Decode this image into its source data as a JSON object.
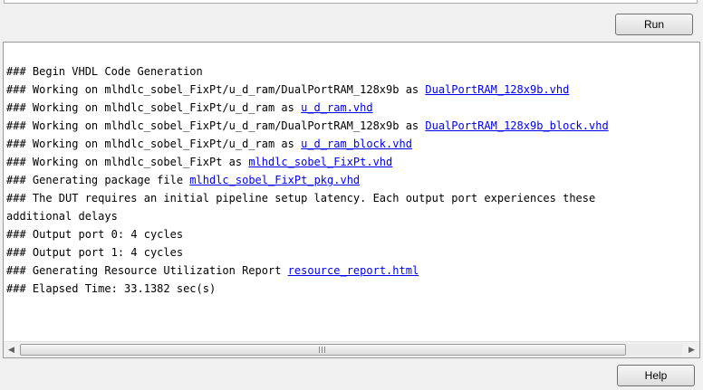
{
  "toolbar": {
    "run_label": "Run"
  },
  "footer": {
    "help_label": "Help"
  },
  "console": {
    "lines": [
      {
        "text": "### Begin VHDL Code Generation",
        "link": ""
      },
      {
        "text": "### Working on mlhdlc_sobel_FixPt/u_d_ram/DualPortRAM_128x9b as ",
        "link": "DualPortRAM_128x9b.vhd"
      },
      {
        "text": "### Working on mlhdlc_sobel_FixPt/u_d_ram as ",
        "link": "u_d_ram.vhd"
      },
      {
        "text": "### Working on mlhdlc_sobel_FixPt/u_d_ram/DualPortRAM_128x9b as ",
        "link": "DualPortRAM_128x9b_block.vhd"
      },
      {
        "text": "### Working on mlhdlc_sobel_FixPt/u_d_ram as ",
        "link": "u_d_ram_block.vhd"
      },
      {
        "text": "### Working on mlhdlc_sobel_FixPt as ",
        "link": "mlhdlc_sobel_FixPt.vhd"
      },
      {
        "text": "### Generating package file ",
        "link": "mlhdlc_sobel_FixPt_pkg.vhd"
      },
      {
        "text": "### The DUT requires an initial pipeline setup latency. Each output port experiences these",
        "link": ""
      },
      {
        "text": "additional delays",
        "link": ""
      },
      {
        "text": "### Output port 0: 4 cycles",
        "link": ""
      },
      {
        "text": "### Output port 1: 4 cycles",
        "link": ""
      },
      {
        "text": "### Generating Resource Utilization Report ",
        "link": "resource_report.html"
      },
      {
        "text": "### Elapsed Time: 33.1382 sec(s)",
        "link": ""
      }
    ]
  },
  "scrollbar": {
    "left_arrow_icon": "chevron-left-icon",
    "right_arrow_icon": "chevron-right-icon"
  }
}
